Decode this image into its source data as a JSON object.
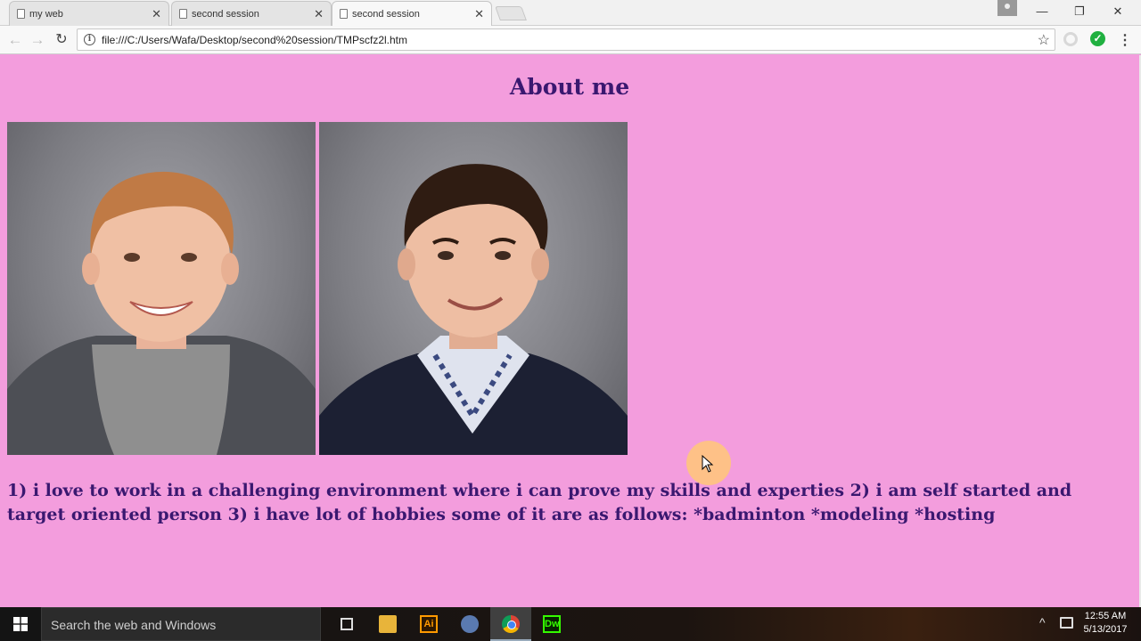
{
  "browser": {
    "tabs": [
      {
        "title": "my web",
        "active": false
      },
      {
        "title": "second session",
        "active": false
      },
      {
        "title": "second session",
        "active": true
      }
    ],
    "close_glyph": "✕",
    "window_controls": {
      "minimize": "—",
      "restore": "❐",
      "close": "✕"
    },
    "nav": {
      "back": "←",
      "forward": "→",
      "reload": "↻"
    },
    "address": {
      "url": "file:///C:/Users/Wafa/Desktop/second%20session/TMPscfz2l.htm",
      "info_glyph": "i",
      "star_glyph": "☆"
    },
    "ext_check_glyph": "✓",
    "menu_glyph": "⋮"
  },
  "page": {
    "background_color": "#f39ddd",
    "text_color": "#3a1870",
    "title": "About me",
    "photos": [
      {
        "name": "boy-photo"
      },
      {
        "name": "man-photo"
      }
    ],
    "paragraph": "1) i love to work in a challenging environment where i can prove my skills and experties 2) i am self started and target oriented person 3) i have lot of hobbies some of it are as follows: *badminton *modeling *hosting"
  },
  "taskbar": {
    "search_placeholder": "Search the web and Windows",
    "apps": [
      {
        "icon": "task-view-icon"
      },
      {
        "icon": "file-explorer-icon"
      },
      {
        "icon": "illustrator-icon",
        "label": "Ai"
      },
      {
        "icon": "edge-icon"
      },
      {
        "icon": "chrome-icon",
        "active": true
      },
      {
        "icon": "dreamweaver-icon",
        "label": "Dw"
      }
    ],
    "tray_chevron": "^",
    "clock_time": "12:55 AM",
    "clock_date": "5/13/2017"
  }
}
